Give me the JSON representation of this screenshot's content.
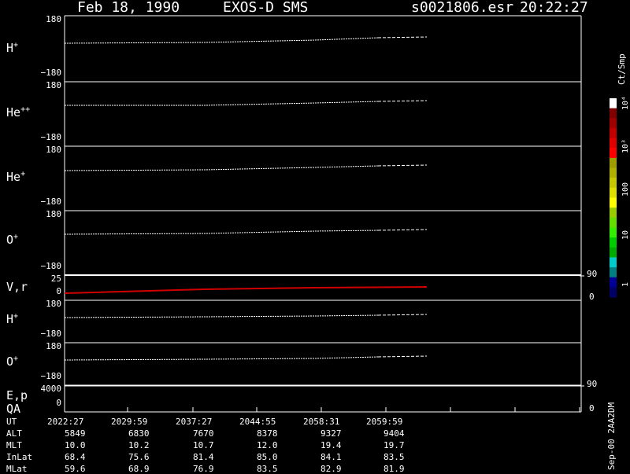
{
  "header": {
    "date": "Feb 18, 1990",
    "instrument": "EXOS-D SMS",
    "file": "s0021806.esr",
    "time": "20:22:27"
  },
  "panels": [
    {
      "label_base": "H",
      "label_sup": "+",
      "ymax": "180",
      "ymin": "−180"
    },
    {
      "label_base": "He",
      "label_sup": "++",
      "ymax": "180",
      "ymin": "−180"
    },
    {
      "label_base": "He",
      "label_sup": "+",
      "ymax": "180",
      "ymin": "−180"
    },
    {
      "label_base": "O",
      "label_sup": "+",
      "ymax": "180",
      "ymin": "−180"
    },
    {
      "label_base": "V,r",
      "label_sup": "",
      "ymax": "25",
      "ymin": "0",
      "right_max": "90",
      "right_min": "0"
    },
    {
      "label_base": "H",
      "label_sup": "+",
      "ymax": "180",
      "ymin": "−180"
    },
    {
      "label_base": "O",
      "label_sup": "+",
      "ymax": "180",
      "ymin": "−180"
    },
    {
      "label_base": "E,p",
      "label2": "QA",
      "ymax": "4000",
      "ymin": "0",
      "right_max": "90",
      "right_min": "0"
    }
  ],
  "colorbar": {
    "unit": "Ct/Smp",
    "labels": [
      "10⁴",
      "10³",
      "100",
      "10",
      "1"
    ],
    "colors": [
      "#ffffff",
      "#800000",
      "#a00000",
      "#c00000",
      "#e00000",
      "#ff0000",
      "#9e9e00",
      "#b0b000",
      "#c8c800",
      "#e0e000",
      "#ffff00",
      "#99cc00",
      "#66dd00",
      "#33ee00",
      "#00cc00",
      "#00aa00",
      "#00cccc",
      "#008080",
      "#000099",
      "#000066"
    ]
  },
  "orbit": {
    "rows": [
      {
        "name": "UT",
        "values": [
          "2022:27",
          "2029:59",
          "2037:27",
          "2044:55",
          "2058:31",
          "2059:59"
        ]
      },
      {
        "name": "ALT",
        "values": [
          "5849",
          "6830",
          "7670",
          "8378",
          "9327",
          "9404"
        ]
      },
      {
        "name": "MLT",
        "values": [
          "10.0",
          "10.2",
          "10.7",
          "12.0",
          "19.4",
          "19.7"
        ]
      },
      {
        "name": "InLat",
        "values": [
          "68.4",
          "75.6",
          "81.4",
          "85.0",
          "84.1",
          "83.5"
        ]
      },
      {
        "name": "MLat",
        "values": [
          "59.6",
          "68.9",
          "76.9",
          "83.5",
          "82.9",
          "81.9"
        ]
      }
    ]
  },
  "footer_code": "Sep-00 2AA2DM",
  "colors": {
    "background": "#000000",
    "axis": "#ffffff",
    "trace": "#ffffff",
    "v_trace": "#d00000"
  }
}
